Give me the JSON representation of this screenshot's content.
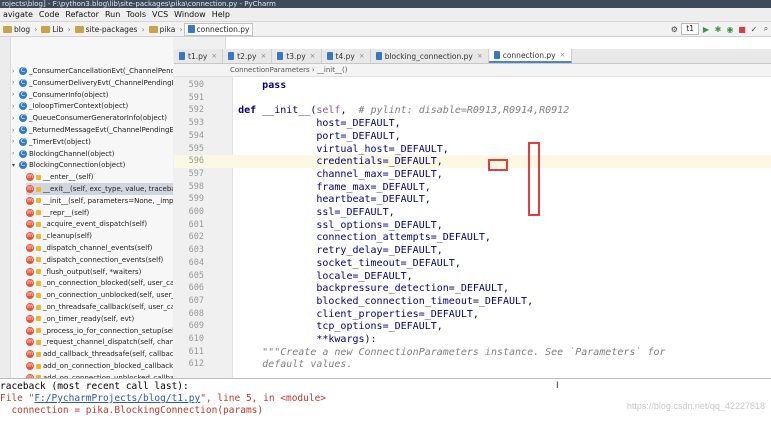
{
  "window": {
    "title": "rojects\\blog] - F:\\python3.blog\\lib\\site-packages\\pika\\connection.py - PyCharm"
  },
  "menu": [
    "avigate",
    "Code",
    "Refactor",
    "Run",
    "Tools",
    "VCS",
    "Window",
    "Help"
  ],
  "breadcrumbs": [
    "blog",
    "Lib",
    "site-packages",
    "pika",
    "connection.py"
  ],
  "run_config": "t1",
  "sidebar": {
    "items": [
      {
        "label": "_ConsumerCancellationEvt(_ChannelPendingEvt)",
        "kind": "class",
        "expanded": false
      },
      {
        "label": "_ConsumerDeliveryEvt(_ChannelPendingEvt)",
        "kind": "class",
        "expanded": false
      },
      {
        "label": "_ConsumerInfo(object)",
        "kind": "class",
        "expanded": false
      },
      {
        "label": "_IoloopTimerContext(object)",
        "kind": "class",
        "expanded": false
      },
      {
        "label": "_QueueConsumerGeneratorInfo(object)",
        "kind": "class",
        "expanded": false
      },
      {
        "label": "_ReturnedMessageEvt(_ChannelPendingEvt)",
        "kind": "class",
        "expanded": false
      },
      {
        "label": "_TimerEvt(object)",
        "kind": "class",
        "expanded": false
      },
      {
        "label": "BlockingChannel(object)",
        "kind": "class",
        "expanded": false
      },
      {
        "label": "BlockingConnection(object)",
        "kind": "class",
        "expanded": true
      },
      {
        "label": "__enter__(self)",
        "kind": "method"
      },
      {
        "label": "__exit__(self, exc_type, value, traceback)",
        "kind": "method",
        "selected": true
      },
      {
        "label": "__init__(self, parameters=None, _impl_cla",
        "kind": "method"
      },
      {
        "label": "__repr__(self)",
        "kind": "method"
      },
      {
        "label": "_acquire_event_dispatch(self)",
        "kind": "method"
      },
      {
        "label": "_cleanup(self)",
        "kind": "method"
      },
      {
        "label": "_dispatch_channel_events(self)",
        "kind": "method"
      },
      {
        "label": "_dispatch_connection_events(self)",
        "kind": "method"
      },
      {
        "label": "_flush_output(self, *waiters)",
        "kind": "method"
      },
      {
        "label": "_on_connection_blocked(self, user_callba",
        "kind": "method"
      },
      {
        "label": "_on_connection_unblocked(self, user_ca",
        "kind": "method"
      },
      {
        "label": "_on_threadsafe_callback(self, user_callba",
        "kind": "method"
      },
      {
        "label": "_on_timer_ready(self, evt)",
        "kind": "method"
      },
      {
        "label": "_process_io_for_connection_setup(self)",
        "kind": "method"
      },
      {
        "label": "_request_channel_dispatch(self, channel",
        "kind": "method"
      },
      {
        "label": "add_callback_threadsafe(self, callback)",
        "kind": "method"
      },
      {
        "label": "add_on_connection_blocked_callback(se",
        "kind": "method"
      },
      {
        "label": "add_on_connection_unblocked_callback(s",
        "kind": "method"
      }
    ]
  },
  "tabs": [
    {
      "label": "t1.py",
      "active": false
    },
    {
      "label": "t2.py",
      "active": false
    },
    {
      "label": "t3.py",
      "active": false
    },
    {
      "label": "t4.py",
      "active": false
    },
    {
      "label": "blocking_connection.py",
      "active": false
    },
    {
      "label": "connection.py",
      "active": true
    }
  ],
  "editor": {
    "breadcrumb": "ConnectionParameters  ›  __init__()",
    "lines": [
      {
        "n": "590",
        "text": "        pass"
      },
      {
        "n": "591",
        "text": ""
      },
      {
        "n": "592",
        "text": "    def __init__(self,  # pylint: disable=R0913,R0914,R0912"
      },
      {
        "n": "593",
        "text": "                 host=_DEFAULT,"
      },
      {
        "n": "594",
        "text": "                 port=_DEFAULT,"
      },
      {
        "n": "595",
        "text": "                 virtual_host=_DEFAULT,"
      },
      {
        "n": "596",
        "text": "                 credentials=_DEFAULT,"
      },
      {
        "n": "597",
        "text": "                 channel_max=_DEFAULT,"
      },
      {
        "n": "598",
        "text": "                 frame_max=_DEFAULT,"
      },
      {
        "n": "599",
        "text": "                 heartbeat=_DEFAULT,"
      },
      {
        "n": "600",
        "text": "                 ssl=_DEFAULT,"
      },
      {
        "n": "601",
        "text": "                 ssl_options=_DEFAULT,"
      },
      {
        "n": "602",
        "text": "                 connection_attempts=_DEFAULT,"
      },
      {
        "n": "603",
        "text": "                 retry_delay=_DEFAULT,"
      },
      {
        "n": "604",
        "text": "                 socket_timeout=_DEFAULT,"
      },
      {
        "n": "605",
        "text": "                 locale=_DEFAULT,"
      },
      {
        "n": "606",
        "text": "                 backpressure_detection=_DEFAULT,"
      },
      {
        "n": "607",
        "text": "                 blocked_connection_timeout=_DEFAULT,"
      },
      {
        "n": "608",
        "text": "                 client_properties=_DEFAULT,"
      },
      {
        "n": "609",
        "text": "                 tcp_options=_DEFAULT,"
      },
      {
        "n": "610",
        "text": "                 **kwargs):"
      },
      {
        "n": "611",
        "text": "        \"\"\"Create a new ConnectionParameters instance. See `Parameters` for"
      },
      {
        "n": "612",
        "text": "        default values."
      }
    ]
  },
  "console": {
    "lines": [
      "raceback (most recent call last):",
      "File \"F:/PycharmProjects/blog/t1.py\", line 5, in <module>",
      "  connection = pika.BlockingConnection(params)"
    ]
  },
  "watermark": "https://blog.csdn.net/qq_42227818"
}
